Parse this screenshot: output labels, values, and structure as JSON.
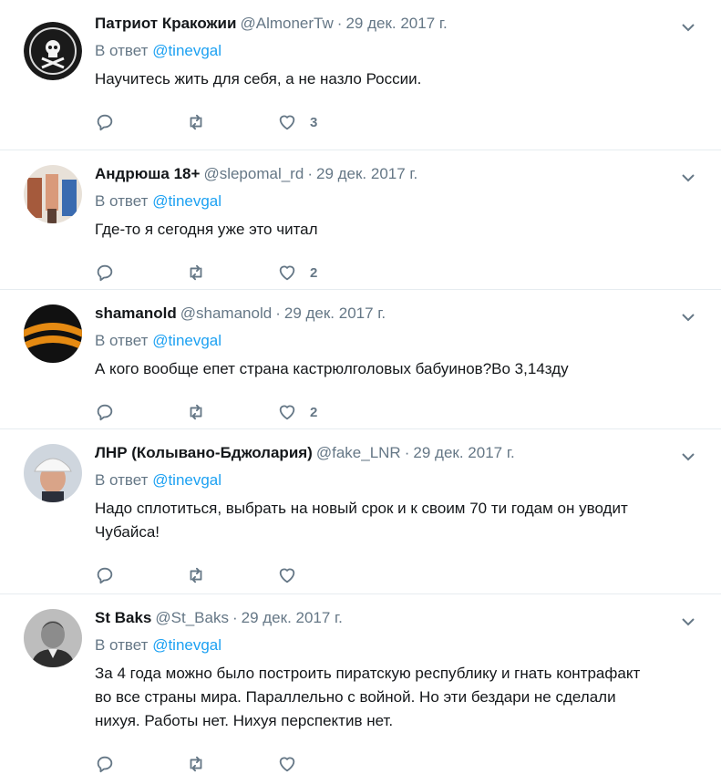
{
  "colors": {
    "accent": "#1da1f2",
    "muted": "#657786",
    "text": "#14171a",
    "divider": "#e6ecf0"
  },
  "tweets": [
    {
      "name": "Патриот Кракожии",
      "handle": "@AlmonerTw",
      "date": "29 дек. 2017 г.",
      "reply_prefix": "В ответ",
      "reply_to": "@tinevgal",
      "text": "Научитесь жить для себя, а не назло России.",
      "likes": "3",
      "avatar": "skull-flag-avatar"
    },
    {
      "name": "Андрюша 18+",
      "handle": "@slepomal_rd",
      "date": "29 дек. 2017 г.",
      "reply_prefix": "В ответ",
      "reply_to": "@tinevgal",
      "text": "Где-то я сегодня уже это читал",
      "likes": "2",
      "avatar": "photo-avatar"
    },
    {
      "name": "shamanold",
      "handle": "@shamanold",
      "date": "29 дек. 2017 г.",
      "reply_prefix": "В ответ",
      "reply_to": "@tinevgal",
      "text": "А кого вообще епет страна кастрюлголовых бабуинов?Во 3,14зду",
      "likes": "2",
      "avatar": "ribbon-avatar"
    },
    {
      "name": "ЛНР (Колывано-Бджолария)",
      "handle": "@fake_LNR",
      "date": "29 дек. 2017 г.",
      "reply_prefix": "В ответ",
      "reply_to": "@tinevgal",
      "text": "Надо сплотиться, выбрать на новый срок и к своим 70 ти годам он уводит Чубайса!",
      "likes": "",
      "avatar": "hardhat-avatar"
    },
    {
      "name": "St Baks",
      "handle": "@St_Baks",
      "date": "29 дек. 2017 г.",
      "reply_prefix": "В ответ",
      "reply_to": "@tinevgal",
      "text": "За 4 года можно было построить пиратскую республику и гнать контрафакт во все страны мира. Параллельно с войной. Но эти бездари не сделали нихуя. Работы нет. Нихуя перспектив нет.",
      "likes": "",
      "avatar": "portrait-avatar"
    }
  ]
}
